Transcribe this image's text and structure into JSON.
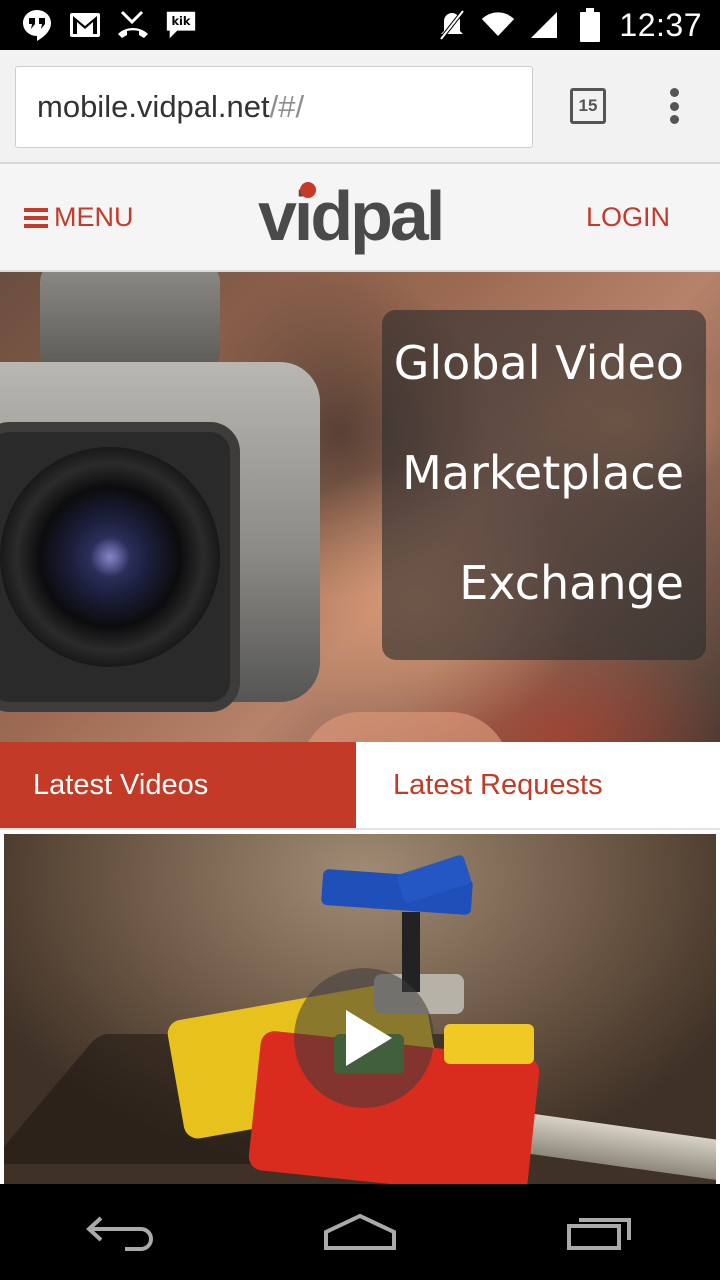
{
  "status_bar": {
    "time": "12:37",
    "icons": [
      "hangouts-icon",
      "gmail-icon",
      "missed-call-icon",
      "kik-icon",
      "mute-icon",
      "wifi-icon",
      "signal-icon",
      "battery-icon"
    ],
    "kik_label": "kik"
  },
  "browser": {
    "url_host": "mobile.vidpal.net",
    "url_path": "/#/",
    "tab_count": "15"
  },
  "site_header": {
    "menu_label": "MENU",
    "logo_text": "vidpal",
    "login_label": "LOGIN"
  },
  "hero": {
    "lines": [
      "Global Video",
      "Marketplace",
      "Exchange"
    ]
  },
  "tabs": [
    {
      "label": "Latest Videos",
      "active": true
    },
    {
      "label": "Latest Requests",
      "active": false
    }
  ],
  "colors": {
    "accent": "#c33a26",
    "header_bg": "#f5f5f5",
    "chrome_bg": "#f2f2f2"
  }
}
